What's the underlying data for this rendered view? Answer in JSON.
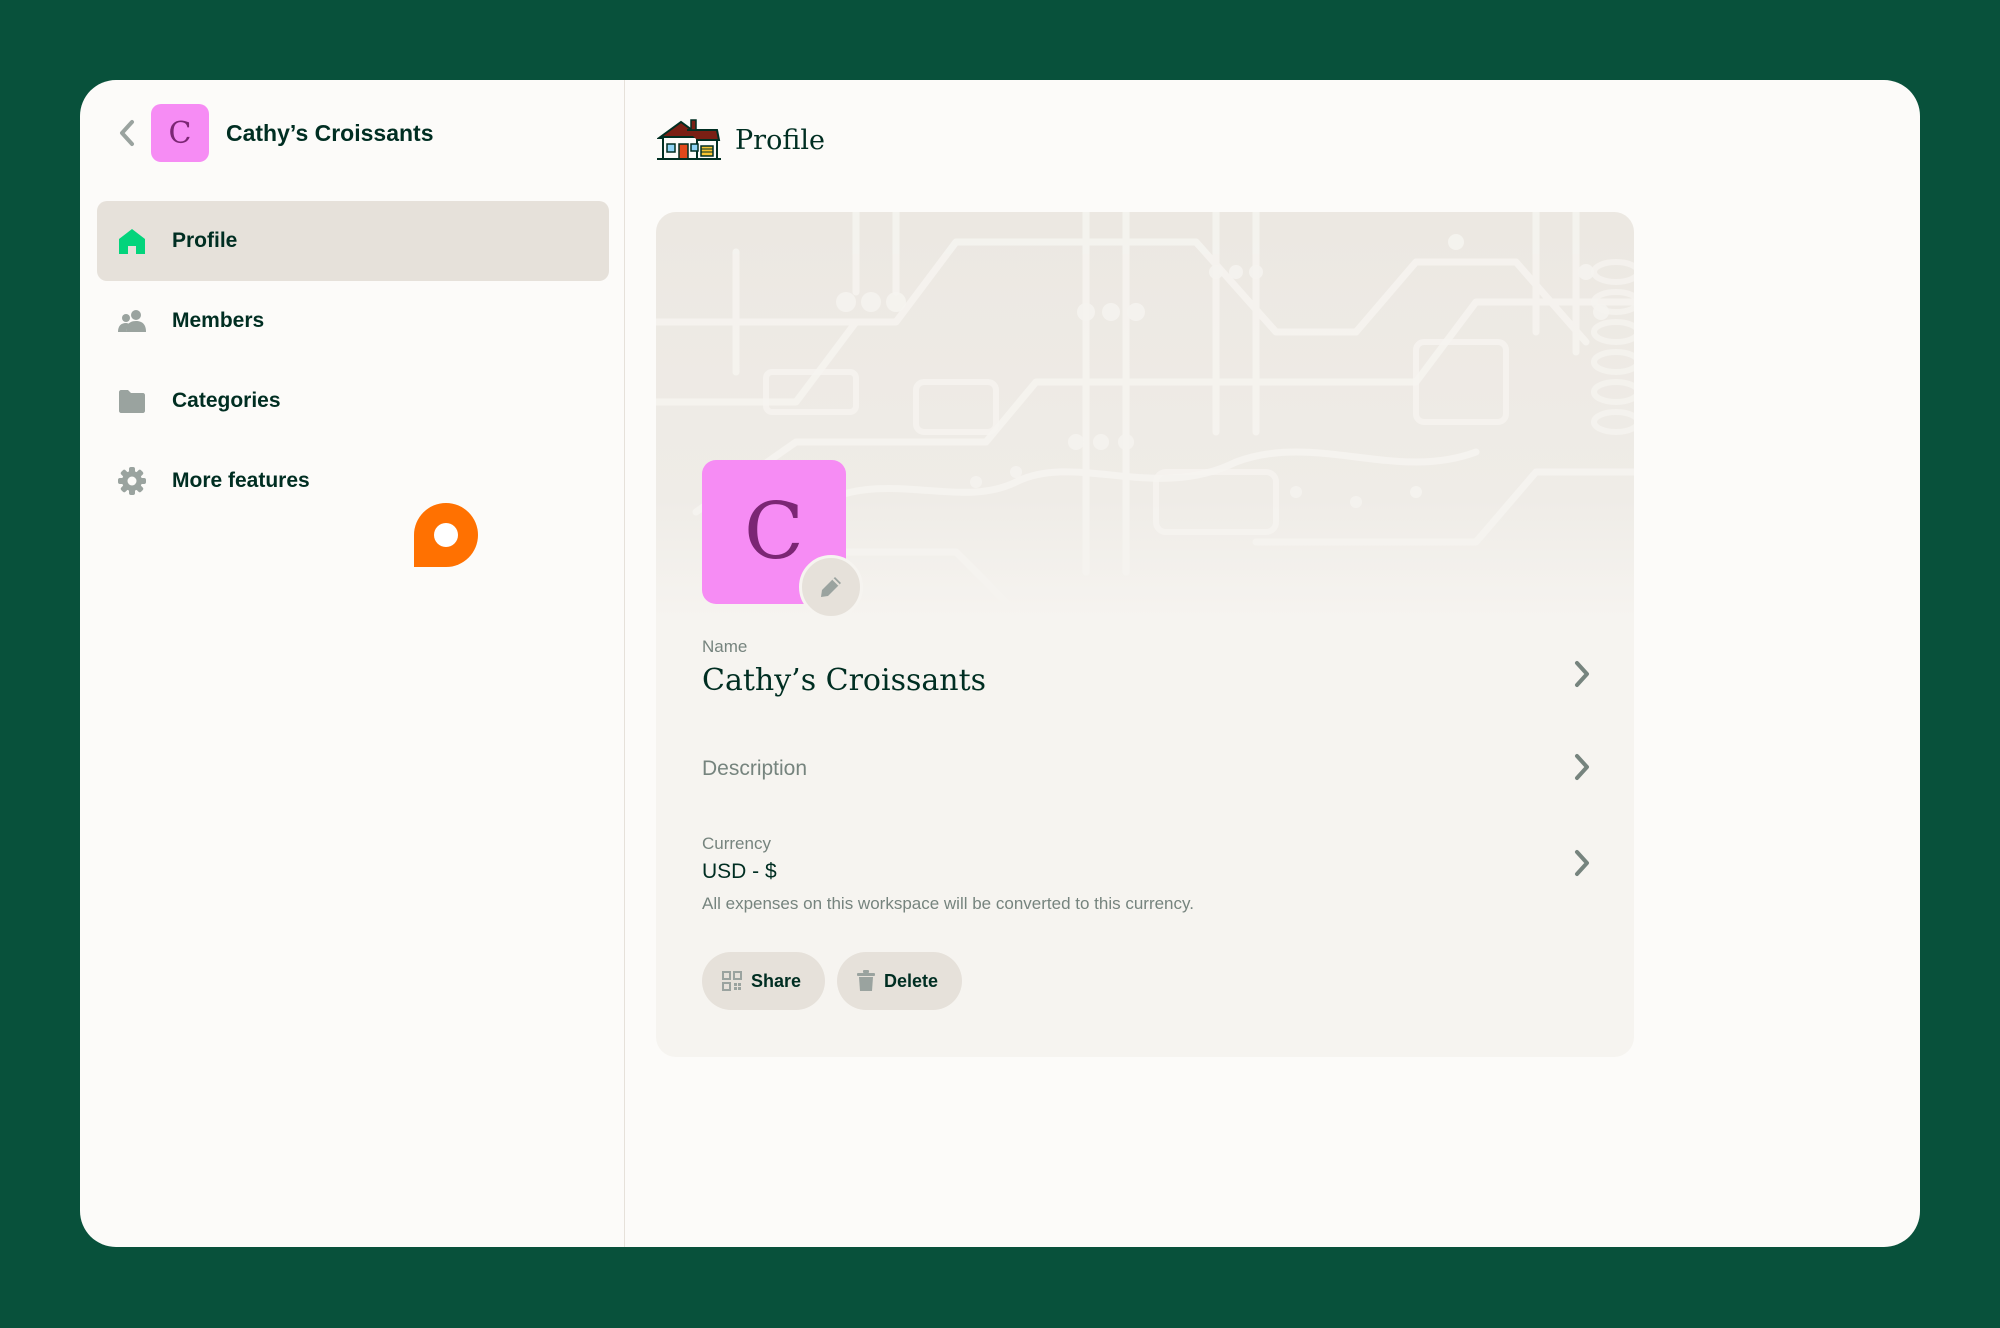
{
  "colors": {
    "page_bg": "#08513b",
    "panel_bg": "#fcfbf9",
    "card_bg": "#f6f4f0",
    "active_bg": "#e6e1da",
    "text": "#002e22",
    "muted": "#76847e",
    "avatar_bg": "#f68cf4",
    "avatar_text": "#7b2674",
    "fab": "#ff7101",
    "accent_green": "#03d47c"
  },
  "workspace": {
    "initial": "C",
    "name": "Cathy’s Croissants"
  },
  "sidebar": {
    "items": [
      {
        "label": "Profile",
        "icon": "home-icon",
        "active": true
      },
      {
        "label": "Members",
        "icon": "users-icon",
        "active": false
      },
      {
        "label": "Categories",
        "icon": "folder-icon",
        "active": false
      },
      {
        "label": "More features",
        "icon": "gear-icon",
        "active": false
      }
    ]
  },
  "page": {
    "title": "Profile",
    "icon": "house-illustration-icon"
  },
  "profile": {
    "avatar_initial": "C",
    "name_label": "Name",
    "name_value": "Cathy’s Croissants",
    "description_placeholder": "Description",
    "currency_label": "Currency",
    "currency_value": "USD - $",
    "currency_hint": "All expenses on this workspace will be converted to this currency."
  },
  "actions": {
    "share_label": "Share",
    "delete_label": "Delete"
  }
}
